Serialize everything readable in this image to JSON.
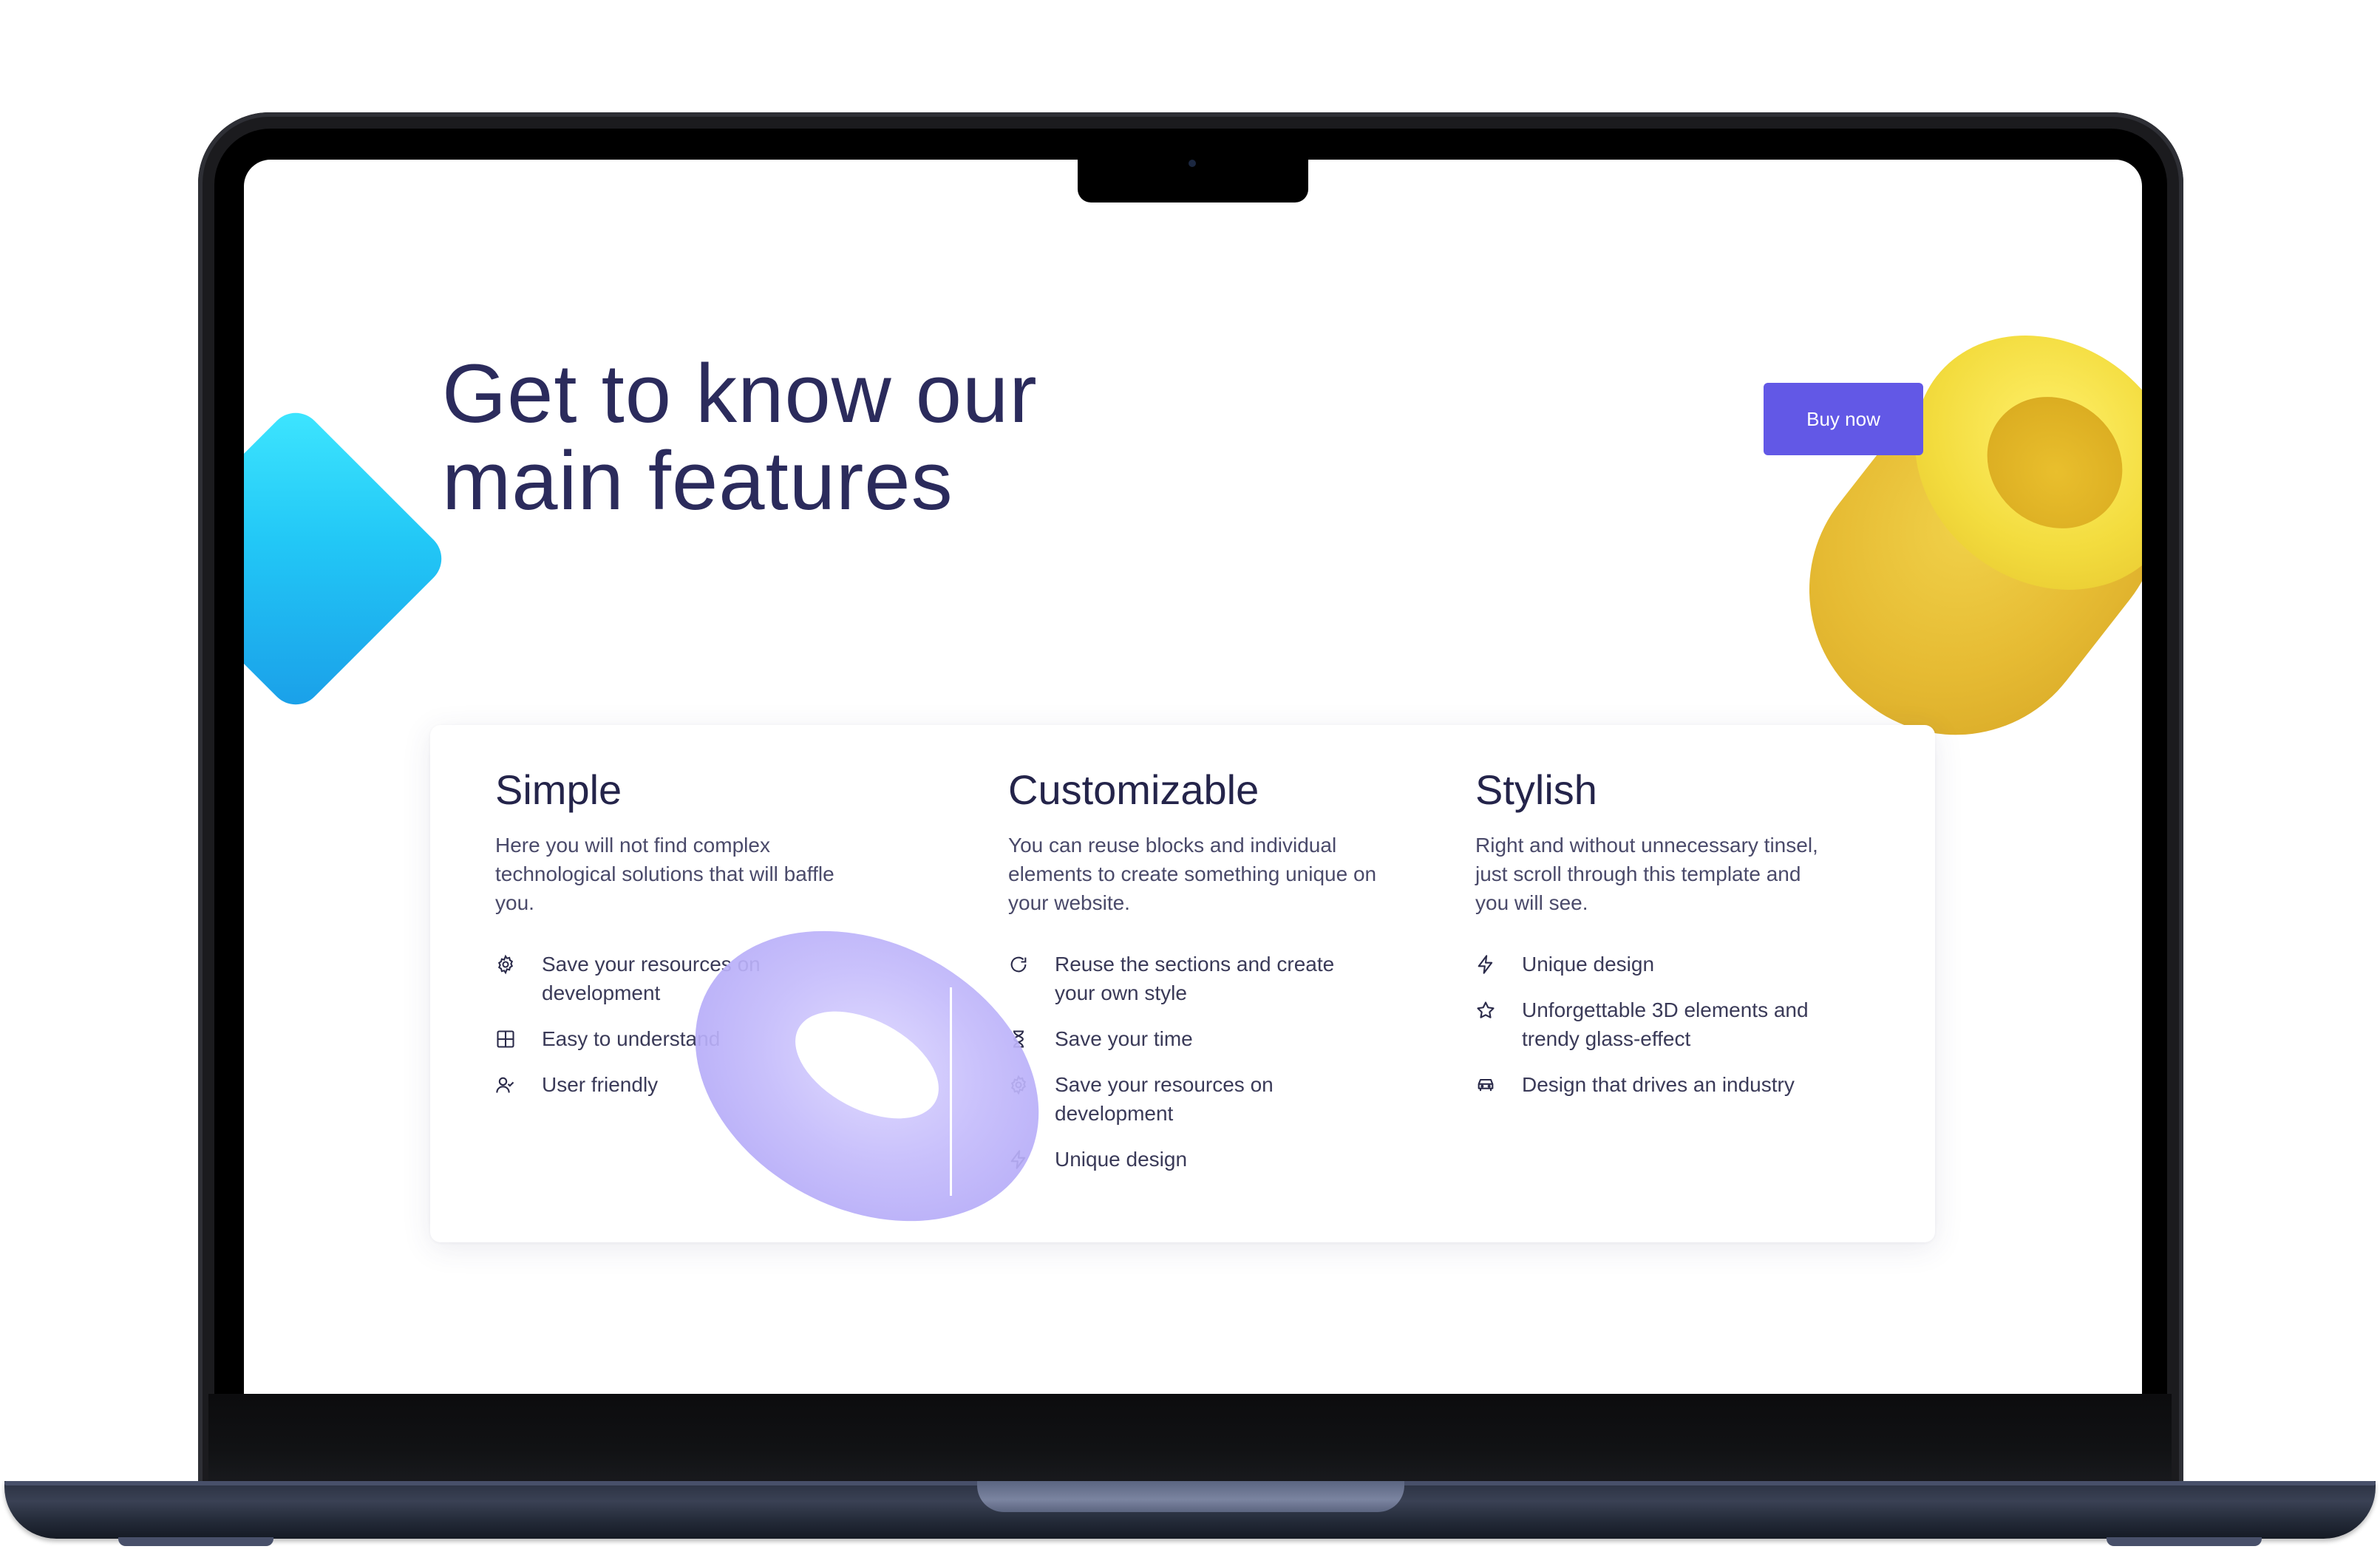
{
  "page": {
    "title": "Get to know our main features",
    "buy_button": "Buy now"
  },
  "features": [
    {
      "heading": "Simple",
      "description": "Here you will not find complex technological solutions that will baffle you.",
      "items": [
        {
          "icon": "gear-icon",
          "text": "Save your resources on development"
        },
        {
          "icon": "grid-icon",
          "text": "Easy to understand"
        },
        {
          "icon": "user-check-icon",
          "text": "User friendly"
        }
      ]
    },
    {
      "heading": "Customizable",
      "description": "You can reuse blocks and individual elements to create something unique on your website.",
      "items": [
        {
          "icon": "refresh-icon",
          "text": "Reuse the sections and create your own style"
        },
        {
          "icon": "hourglass-icon",
          "text": "Save your time"
        },
        {
          "icon": "gear-icon",
          "text": "Save your resources on development"
        },
        {
          "icon": "bolt-icon",
          "text": "Unique design"
        }
      ]
    },
    {
      "heading": "Stylish",
      "description": "Right and without unnecessary tinsel, just scroll through this template and you will see.",
      "items": [
        {
          "icon": "bolt-icon",
          "text": "Unique design"
        },
        {
          "icon": "star-icon",
          "text": "Unforgettable 3D elements and trendy glass-effect"
        },
        {
          "icon": "car-icon",
          "text": "Design that drives an industry"
        }
      ]
    }
  ],
  "colors": {
    "accent": "#6258e6",
    "heading": "#2b2b5c",
    "body_text": "#4a4a6a"
  }
}
